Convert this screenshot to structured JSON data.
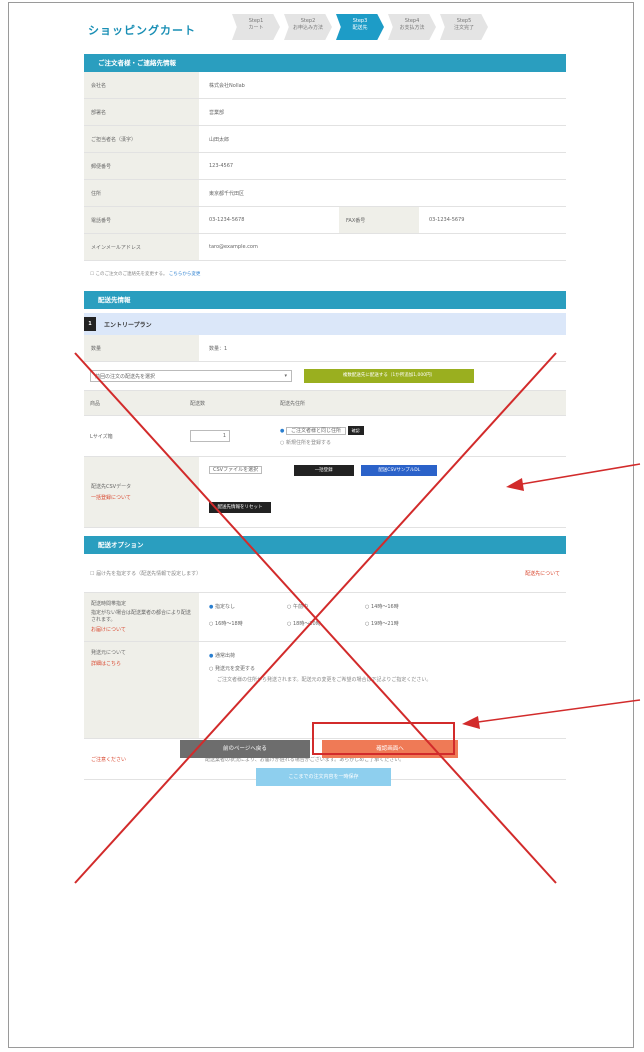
{
  "header": {
    "cart_title": "ショッピングカート",
    "steps": [
      {
        "num": "Step1",
        "label": "カート"
      },
      {
        "num": "Step2",
        "label": "お申込み方法"
      },
      {
        "num": "Step3",
        "label": "配送先"
      },
      {
        "num": "Step4",
        "label": "お支払方法"
      },
      {
        "num": "Step5",
        "label": "注文完了"
      }
    ],
    "active_step": 3
  },
  "orderer": {
    "title": "ご注文者様・ご連絡先情報",
    "rows": [
      {
        "label": "会社名",
        "value": "株式会社Nollab"
      },
      {
        "label": "部署名",
        "value": "営業部"
      },
      {
        "label": "ご担当者名（漢字）",
        "value": "山田太郎"
      },
      {
        "label": "郵便番号",
        "value": "123-4567"
      },
      {
        "label": "住所",
        "value": "東京都千代田区"
      }
    ],
    "phone": {
      "label": "電話番号",
      "value": "03-1234-5678",
      "label2": "FAX番号",
      "value2": "03-1234-5679"
    },
    "email": {
      "label": "メインメールアドレス",
      "value": "taro@example.com"
    },
    "note": "このご注文のご連絡先を変更する。",
    "note_link": "こちらから変更"
  },
  "delivery": {
    "title": "配送先情報",
    "plan_num": "1",
    "plan_name": "エントリープラン",
    "qty_label": "数量",
    "qty_value": "数量：1",
    "select_text": "前回の注文の配送先を選択",
    "green_btn": "複数配送先に配送する（1か所追加1,000円）",
    "col_product": "商品",
    "col_qty": "配送数",
    "col_dest": "配送先住所",
    "item_name": "Lサイズ箱",
    "item_qty": "1",
    "dest_option1": "ご注文者様と同じ住所",
    "dest_btn": "確認",
    "dest_option2": "新規住所を登録する",
    "copy_label": "配送先CSVデータ",
    "copy_link": "一括登録について",
    "csv_text": "CSVファイルを選択",
    "btn_confirm": "一括登録",
    "btn_sample": "配送CSVサンプルDL",
    "reset_btn": "配送先情報をリセット"
  },
  "options": {
    "title": "配送オプション",
    "check_text": "届け先を指定する（配送先情報で設定します）",
    "check_link": "配送先について",
    "time_label": "配送時間帯指定",
    "time_note": "指定がない場合は配送業者の都合により配送されます。",
    "time_link": "お届けについて",
    "times": [
      "指定なし",
      "午前中",
      "14時〜16時",
      "16時〜18時",
      "18時〜20時",
      "19時〜21時"
    ],
    "gift_label": "発送元について",
    "gift_link": "詳細はこちら",
    "gift_option1": "通常出荷",
    "gift_option2": "発送元を変更する",
    "gift_desc": "ご注文者様の住所から発送されます。配送元の変更をご希望の場合は下記よりご指定ください。",
    "caution_label": "ご注意ください",
    "caution_text": "配送業者の状況により、お届けが遅れる場合がございます。あらかじめご了承ください。"
  },
  "footer": {
    "prev": "前のページへ戻る",
    "next": "確認画面へ",
    "save": "ここまでの注文内容を一時保存"
  },
  "colors": {
    "accent": "#2a9ebf",
    "next_button": "#ef7a56",
    "annotation": "#d22b2b"
  }
}
